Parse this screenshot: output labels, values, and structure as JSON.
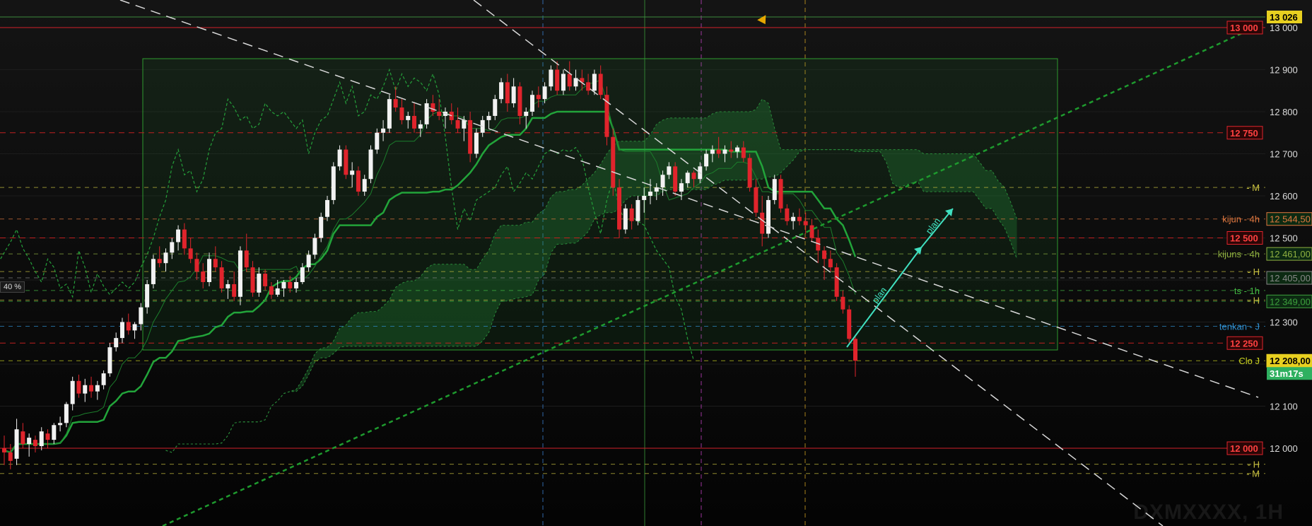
{
  "chart_data": {
    "type": "candlestick",
    "symbol": "DXMXXXX, 1H",
    "y_range": [
      11925,
      13050
    ],
    "y_ticks": [
      "13 000",
      "12 900",
      "12 800",
      "12 700",
      "12 600",
      "12 500",
      "12 400",
      "12 300",
      "12 200",
      "12 100",
      "12 000"
    ],
    "price_levels": [
      {
        "value": 13000,
        "label": "13 000",
        "color": "#d0202a",
        "style": "solid"
      },
      {
        "value": 12750,
        "label": "12 750",
        "color": "#c02020",
        "style": "dashed"
      },
      {
        "value": 12500,
        "label": "12 500",
        "color": "#c02020",
        "style": "dashed"
      },
      {
        "value": 12250,
        "label": "12 250",
        "color": "#c02020",
        "style": "dashed"
      },
      {
        "value": 12000,
        "label": "12 000",
        "color": "#d0202a",
        "style": "solid"
      }
    ],
    "annotated_lines": [
      {
        "value": 12620,
        "text": "- M",
        "color": "#c8c040"
      },
      {
        "value": 12545,
        "text": "kijun - 4h",
        "color": "#e07840",
        "tag": "12 544,50"
      },
      {
        "value": 12462,
        "text": "kijuns - 4h",
        "color": "#8fb040",
        "tag": "12 461,00"
      },
      {
        "value": 12420,
        "text": "- H",
        "color": "#c8c040"
      },
      {
        "value": 12405,
        "text": "",
        "color": "#888888",
        "tag": "12 405,00"
      },
      {
        "value": 12375,
        "text": "ts - 1h",
        "color": "#44bb44"
      },
      {
        "value": 12352,
        "text": "- H",
        "color": "#c8c040"
      },
      {
        "value": 12349,
        "text": "",
        "color": "#3da03d",
        "tag": "12 349,00"
      },
      {
        "value": 12290,
        "text": "tenkan - J",
        "color": "#3090d0"
      },
      {
        "value": 12208,
        "text": "Clo J",
        "color": "#c8d020",
        "tag": "12 208,00"
      },
      {
        "value": 11962,
        "text": "- H",
        "color": "#c8c040"
      },
      {
        "value": 11940,
        "text": "- M",
        "color": "#c8c040"
      }
    ],
    "current_price": {
      "tag": "13 026",
      "countdown": "31m17s"
    },
    "plan_labels": [
      "plan",
      "plan"
    ],
    "zoom_label": "40 %",
    "candles": [
      [
        12000,
        12030,
        11960,
        11990
      ],
      [
        11990,
        12010,
        11950,
        11970
      ],
      [
        11975,
        12070,
        11960,
        12045
      ],
      [
        12040,
        12060,
        12000,
        12010
      ],
      [
        12010,
        12035,
        11980,
        12025
      ],
      [
        12020,
        12030,
        11990,
        12005
      ],
      [
        12005,
        12050,
        11995,
        12040
      ],
      [
        12035,
        12045,
        12000,
        12020
      ],
      [
        12020,
        12060,
        12010,
        12055
      ],
      [
        12055,
        12075,
        12040,
        12060
      ],
      [
        12060,
        12110,
        12050,
        12105
      ],
      [
        12105,
        12170,
        12090,
        12160
      ],
      [
        12160,
        12175,
        12120,
        12130
      ],
      [
        12130,
        12165,
        12110,
        12150
      ],
      [
        12150,
        12170,
        12120,
        12135
      ],
      [
        12135,
        12160,
        12115,
        12150
      ],
      [
        12150,
        12185,
        12140,
        12178
      ],
      [
        12178,
        12250,
        12170,
        12240
      ],
      [
        12240,
        12275,
        12230,
        12262
      ],
      [
        12262,
        12310,
        12250,
        12300
      ],
      [
        12300,
        12320,
        12270,
        12280
      ],
      [
        12280,
        12300,
        12260,
        12295
      ],
      [
        12295,
        12345,
        12280,
        12335
      ],
      [
        12335,
        12400,
        12320,
        12390
      ],
      [
        12390,
        12460,
        12380,
        12450
      ],
      [
        12450,
        12480,
        12430,
        12440
      ],
      [
        12440,
        12475,
        12420,
        12465
      ],
      [
        12465,
        12500,
        12450,
        12490
      ],
      [
        12490,
        12530,
        12470,
        12520
      ],
      [
        12520,
        12535,
        12460,
        12475
      ],
      [
        12475,
        12500,
        12440,
        12450
      ],
      [
        12450,
        12465,
        12400,
        12420
      ],
      [
        12420,
        12440,
        12380,
        12395
      ],
      [
        12395,
        12465,
        12385,
        12450
      ],
      [
        12450,
        12480,
        12420,
        12430
      ],
      [
        12430,
        12445,
        12370,
        12380
      ],
      [
        12380,
        12400,
        12355,
        12390
      ],
      [
        12390,
        12420,
        12350,
        12360
      ],
      [
        12360,
        12480,
        12340,
        12470
      ],
      [
        12470,
        12510,
        12420,
        12430
      ],
      [
        12430,
        12445,
        12360,
        12370
      ],
      [
        12370,
        12430,
        12360,
        12415
      ],
      [
        12415,
        12425,
        12375,
        12385
      ],
      [
        12385,
        12395,
        12355,
        12365
      ],
      [
        12365,
        12400,
        12360,
        12380
      ],
      [
        12380,
        12400,
        12360,
        12395
      ],
      [
        12395,
        12410,
        12370,
        12380
      ],
      [
        12380,
        12405,
        12370,
        12395
      ],
      [
        12395,
        12440,
        12390,
        12430
      ],
      [
        12430,
        12470,
        12420,
        12460
      ],
      [
        12460,
        12510,
        12450,
        12500
      ],
      [
        12500,
        12560,
        12490,
        12550
      ],
      [
        12550,
        12600,
        12540,
        12590
      ],
      [
        12590,
        12680,
        12580,
        12670
      ],
      [
        12670,
        12720,
        12660,
        12710
      ],
      [
        12710,
        12720,
        12640,
        12650
      ],
      [
        12650,
        12680,
        12620,
        12660
      ],
      [
        12660,
        12670,
        12600,
        12610
      ],
      [
        12610,
        12650,
        12600,
        12640
      ],
      [
        12640,
        12720,
        12630,
        12710
      ],
      [
        12710,
        12760,
        12700,
        12750
      ],
      [
        12750,
        12780,
        12730,
        12760
      ],
      [
        12760,
        12840,
        12750,
        12830
      ],
      [
        12830,
        12860,
        12800,
        12810
      ],
      [
        12810,
        12830,
        12770,
        12780
      ],
      [
        12780,
        12800,
        12760,
        12790
      ],
      [
        12790,
        12820,
        12750,
        12760
      ],
      [
        12760,
        12780,
        12740,
        12770
      ],
      [
        12770,
        12830,
        12760,
        12820
      ],
      [
        12820,
        12840,
        12790,
        12800
      ],
      [
        12800,
        12830,
        12780,
        12790
      ],
      [
        12790,
        12810,
        12760,
        12800
      ],
      [
        12800,
        12820,
        12770,
        12780
      ],
      [
        12780,
        12810,
        12750,
        12760
      ],
      [
        12760,
        12790,
        12730,
        12780
      ],
      [
        12780,
        12800,
        12680,
        12700
      ],
      [
        12700,
        12760,
        12690,
        12750
      ],
      [
        12750,
        12790,
        12740,
        12780
      ],
      [
        12780,
        12800,
        12760,
        12790
      ],
      [
        12790,
        12840,
        12780,
        12830
      ],
      [
        12830,
        12880,
        12820,
        12870
      ],
      [
        12870,
        12890,
        12800,
        12820
      ],
      [
        12820,
        12880,
        12810,
        12860
      ],
      [
        12860,
        12870,
        12770,
        12790
      ],
      [
        12790,
        12810,
        12760,
        12800
      ],
      [
        12800,
        12850,
        12790,
        12840
      ],
      [
        12840,
        12860,
        12810,
        12830
      ],
      [
        12830,
        12870,
        12820,
        12860
      ],
      [
        12860,
        12910,
        12850,
        12900
      ],
      [
        12900,
        12920,
        12840,
        12850
      ],
      [
        12850,
        12900,
        12840,
        12890
      ],
      [
        12890,
        12920,
        12850,
        12860
      ],
      [
        12860,
        12900,
        12850,
        12880
      ],
      [
        12880,
        12900,
        12850,
        12870
      ],
      [
        12870,
        12890,
        12840,
        12850
      ],
      [
        12850,
        12900,
        12840,
        12890
      ],
      [
        12890,
        12910,
        12830,
        12840
      ],
      [
        12840,
        12860,
        12720,
        12740
      ],
      [
        12740,
        12760,
        12600,
        12620
      ],
      [
        12620,
        12640,
        12500,
        12520
      ],
      [
        12520,
        12580,
        12510,
        12570
      ],
      [
        12570,
        12580,
        12520,
        12540
      ],
      [
        12540,
        12600,
        12530,
        12590
      ],
      [
        12590,
        12620,
        12560,
        12600
      ],
      [
        12600,
        12640,
        12580,
        12610
      ],
      [
        12610,
        12630,
        12590,
        12620
      ],
      [
        12620,
        12660,
        12600,
        12650
      ],
      [
        12650,
        12680,
        12640,
        12670
      ],
      [
        12670,
        12680,
        12600,
        12610
      ],
      [
        12610,
        12640,
        12590,
        12630
      ],
      [
        12630,
        12660,
        12620,
        12655
      ],
      [
        12655,
        12660,
        12620,
        12640
      ],
      [
        12640,
        12680,
        12630,
        12670
      ],
      [
        12670,
        12710,
        12660,
        12700
      ],
      [
        12700,
        12720,
        12680,
        12710
      ],
      [
        12710,
        12740,
        12690,
        12700
      ],
      [
        12700,
        12720,
        12680,
        12710
      ],
      [
        12710,
        12730,
        12690,
        12705
      ],
      [
        12705,
        12720,
        12690,
        12715
      ],
      [
        12715,
        12730,
        12680,
        12690
      ],
      [
        12690,
        12700,
        12610,
        12620
      ],
      [
        12620,
        12640,
        12550,
        12560
      ],
      [
        12560,
        12600,
        12480,
        12510
      ],
      [
        12510,
        12600,
        12500,
        12590
      ],
      [
        12590,
        12650,
        12580,
        12640
      ],
      [
        12640,
        12650,
        12560,
        12570
      ],
      [
        12570,
        12580,
        12530,
        12540
      ],
      [
        12540,
        12560,
        12520,
        12550
      ],
      [
        12550,
        12570,
        12530,
        12540
      ],
      [
        12540,
        12560,
        12510,
        12530
      ],
      [
        12530,
        12545,
        12490,
        12500
      ],
      [
        12500,
        12520,
        12440,
        12470
      ],
      [
        12470,
        12480,
        12400,
        12450
      ],
      [
        12450,
        12470,
        12420,
        12430
      ],
      [
        12430,
        12440,
        12350,
        12360
      ],
      [
        12360,
        12375,
        12320,
        12330
      ],
      [
        12330,
        12340,
        12250,
        12260
      ],
      [
        12260,
        12265,
        12170,
        12208
      ]
    ]
  }
}
